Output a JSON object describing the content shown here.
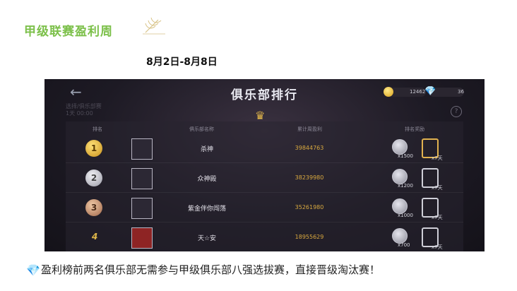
{
  "article": {
    "heading": "甲级联赛盈利周",
    "date": "8月2日-8月8日",
    "note": "盈利榜前两名俱乐部无需参与甲级俱乐部八强选拔赛，直接晋级淘汰赛！"
  },
  "screen": {
    "title": "俱乐部排行",
    "back_faint": "选择/俱乐部赛\n1天 00:00",
    "coins": "12462",
    "gems": "36",
    "help": "?",
    "headers": {
      "rank": "排名",
      "club": "俱乐部名称",
      "profit": "累计周盈利",
      "reward": "排名奖励"
    },
    "rows": [
      {
        "rank": "1",
        "name": "杀神",
        "profit": "39844763",
        "coin_reward": "x1500",
        "days": "x7天"
      },
      {
        "rank": "2",
        "name": "众神殿",
        "profit": "38239980",
        "coin_reward": "x1200",
        "days": "x7天"
      },
      {
        "rank": "3",
        "name": "紫金伴你闯荡",
        "profit": "35261980",
        "coin_reward": "x1000",
        "days": "x7天"
      },
      {
        "rank": "4",
        "name": "天☆安",
        "profit": "18955629",
        "coin_reward": "x700",
        "days": "x7天"
      }
    ]
  }
}
